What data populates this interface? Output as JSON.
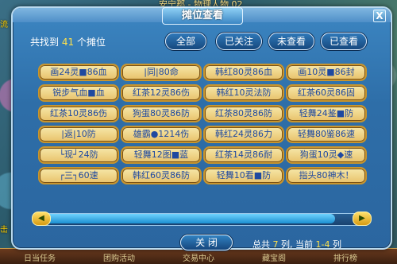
{
  "background": {
    "top_text": "安宁郡 - 物理人物 02",
    "left_text_1": "流",
    "left_text_2": "击",
    "bottom_items": [
      "日当任务",
      "团购活动",
      "交易中心",
      "藏宝阁",
      "排行榜"
    ]
  },
  "dialog": {
    "title": "摊位查看",
    "close_icon": "X",
    "found_prefix": "共找到",
    "found_count": "41",
    "found_suffix": "个摊位",
    "tabs": [
      "全部",
      "已关注",
      "未查看",
      "已查看"
    ],
    "stalls": [
      [
        "画24灵■86血",
        "|同|80命",
        "韩红80灵86血",
        "画10灵■86封"
      ],
      [
        "锐步气血■血",
        "红茶12灵86伤",
        "韩红10灵法防",
        "红茶60灵86固"
      ],
      [
        "红茶10灵86伤",
        "狗蛋80灵86防",
        "红茶80灵86防",
        "轻舞24鉴■防"
      ],
      [
        "|返|10防",
        "雄霸●1214伤",
        "韩红24灵86力",
        "轻舞80鉴86速"
      ],
      [
        "└现┘24防",
        "轻舞12图■蓝",
        "红茶14灵86耐",
        "狗蛋10灵◆速"
      ],
      [
        "┌三┐60速",
        "韩红60灵86防",
        "轻舞10看■防",
        "指头80神木！"
      ]
    ],
    "close_button": "关 闭",
    "pager": {
      "total_prefix": "总共",
      "total": "7",
      "total_unit": "列,",
      "current_prefix": "当前",
      "current": "1-4",
      "current_unit": "列"
    },
    "scroll_left_icon": "◀",
    "scroll_right_icon": "▶"
  }
}
